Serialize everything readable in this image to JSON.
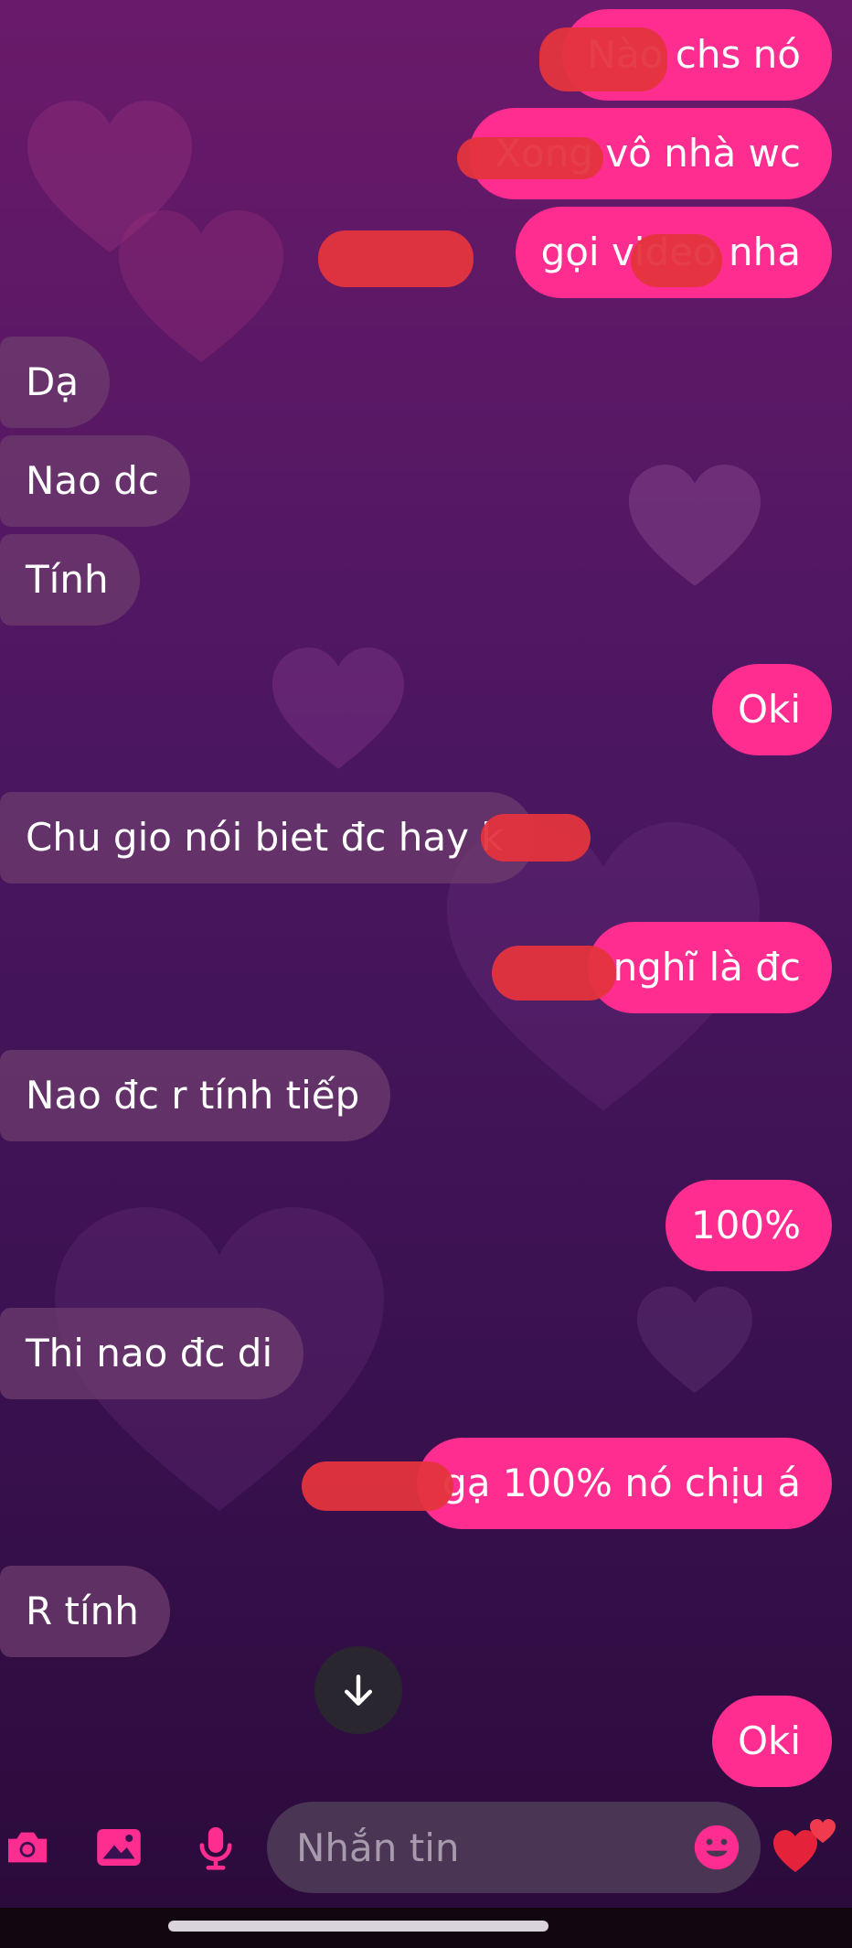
{
  "messages": [
    {
      "side": "out",
      "text": "Nào          chs nó"
    },
    {
      "side": "out",
      "text": "Xong             vô nhà wc"
    },
    {
      "side": "out",
      "text": "                gọi video         nha"
    },
    {
      "side": "in",
      "text": "Dạ"
    },
    {
      "side": "in",
      "text": "Nao dc"
    },
    {
      "side": "in",
      "text": "Tính"
    },
    {
      "side": "out",
      "text": "Oki"
    },
    {
      "side": "in",
      "text": "Chu gio nói biet đc hay k"
    },
    {
      "side": "out",
      "text": "        nghĩ là đc"
    },
    {
      "side": "in",
      "text": "Nao đc r tính tiếp"
    },
    {
      "side": "out",
      "text": "100%"
    },
    {
      "side": "in",
      "text": "Thi nao đc di"
    },
    {
      "side": "out",
      "text": "            gạ 100% nó chịu á"
    },
    {
      "side": "in",
      "text": "R tính"
    },
    {
      "side": "out",
      "text": "Oki"
    }
  ],
  "composer": {
    "placeholder": "Nhắn tin",
    "icons": [
      "camera-icon",
      "gallery-icon",
      "microphone-icon",
      "emoji-icon",
      "hearts-icon"
    ]
  },
  "colors": {
    "outgoing_bubble": "#ff2d8f",
    "incoming_bubble": "#6e3c6e",
    "accent": "#ff2d8f"
  }
}
